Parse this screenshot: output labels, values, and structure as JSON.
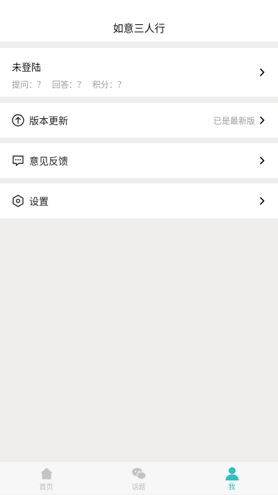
{
  "header": {
    "title": "如意三人行"
  },
  "profile": {
    "name": "未登陆",
    "stats": [
      {
        "label": "提问：？"
      },
      {
        "label": "回答：？"
      },
      {
        "label": "积分：？"
      }
    ]
  },
  "menu": {
    "update": {
      "label": "版本更新",
      "status": "已是最新版",
      "icon": "arrow-up-circle-icon"
    },
    "feedback": {
      "label": "意见反馈",
      "icon": "chat-bubble-icon"
    },
    "settings": {
      "label": "设置",
      "icon": "hexagon-gear-icon"
    }
  },
  "tabbar": {
    "home": {
      "label": "首页",
      "icon": "home-icon"
    },
    "topic": {
      "label": "话题",
      "icon": "chat-icon"
    },
    "me": {
      "label": "我",
      "icon": "person-icon"
    }
  },
  "colors": {
    "accent": "#2cc0c0",
    "background": "#efeeed",
    "inactive": "#bdbdbd"
  }
}
